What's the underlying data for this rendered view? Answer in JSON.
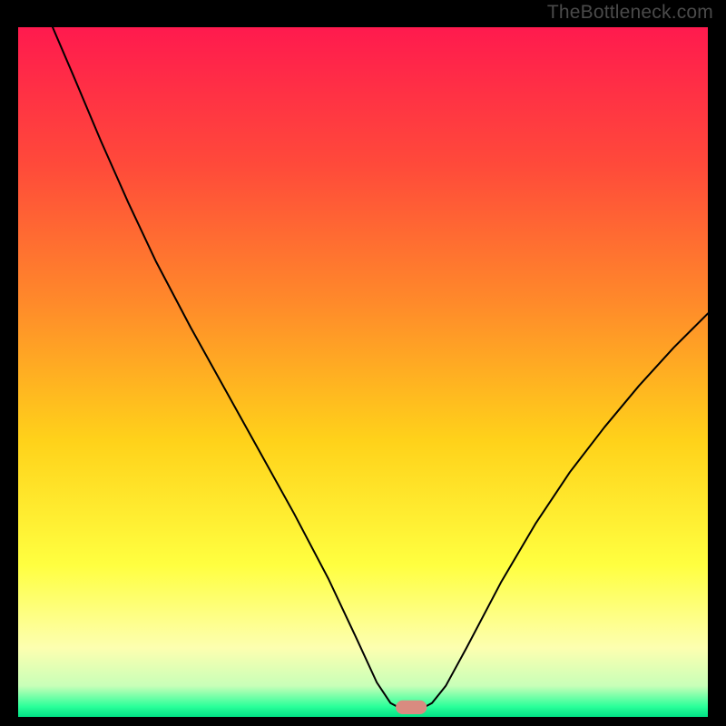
{
  "watermark": "TheBottleneck.com",
  "chart_data": {
    "type": "line",
    "title": "",
    "xlabel": "",
    "ylabel": "",
    "xlim": [
      0,
      100
    ],
    "ylim": [
      0,
      100
    ],
    "grid": false,
    "background_gradient": {
      "stops": [
        {
          "offset": 0.0,
          "color": "#ff1a4e"
        },
        {
          "offset": 0.2,
          "color": "#ff4a3a"
        },
        {
          "offset": 0.4,
          "color": "#ff8a2a"
        },
        {
          "offset": 0.6,
          "color": "#ffd21a"
        },
        {
          "offset": 0.78,
          "color": "#ffff40"
        },
        {
          "offset": 0.9,
          "color": "#fdffb0"
        },
        {
          "offset": 0.955,
          "color": "#c8ffb8"
        },
        {
          "offset": 0.985,
          "color": "#2aff9a"
        },
        {
          "offset": 1.0,
          "color": "#00e084"
        }
      ]
    },
    "series": [
      {
        "name": "bottleneck-curve",
        "stroke": "#000000",
        "stroke_width": 2,
        "points": [
          {
            "x": 5.0,
            "y": 100.0
          },
          {
            "x": 8.0,
            "y": 93.0
          },
          {
            "x": 12.0,
            "y": 83.5
          },
          {
            "x": 16.0,
            "y": 74.5
          },
          {
            "x": 20.0,
            "y": 66.0
          },
          {
            "x": 25.0,
            "y": 56.5
          },
          {
            "x": 30.0,
            "y": 47.5
          },
          {
            "x": 35.0,
            "y": 38.5
          },
          {
            "x": 40.0,
            "y": 29.5
          },
          {
            "x": 45.0,
            "y": 20.0
          },
          {
            "x": 49.0,
            "y": 11.5
          },
          {
            "x": 52.0,
            "y": 5.0
          },
          {
            "x": 54.0,
            "y": 2.0
          },
          {
            "x": 55.5,
            "y": 1.2
          },
          {
            "x": 58.5,
            "y": 1.2
          },
          {
            "x": 60.0,
            "y": 2.0
          },
          {
            "x": 62.0,
            "y": 4.5
          },
          {
            "x": 65.0,
            "y": 10.0
          },
          {
            "x": 70.0,
            "y": 19.5
          },
          {
            "x": 75.0,
            "y": 28.0
          },
          {
            "x": 80.0,
            "y": 35.5
          },
          {
            "x": 85.0,
            "y": 42.0
          },
          {
            "x": 90.0,
            "y": 48.0
          },
          {
            "x": 95.0,
            "y": 53.5
          },
          {
            "x": 100.0,
            "y": 58.5
          }
        ]
      }
    ],
    "marker": {
      "name": "optimal-point",
      "shape": "rounded-rect",
      "x": 57.0,
      "y": 1.4,
      "width": 4.5,
      "height": 2.0,
      "color": "#d98b80"
    }
  }
}
